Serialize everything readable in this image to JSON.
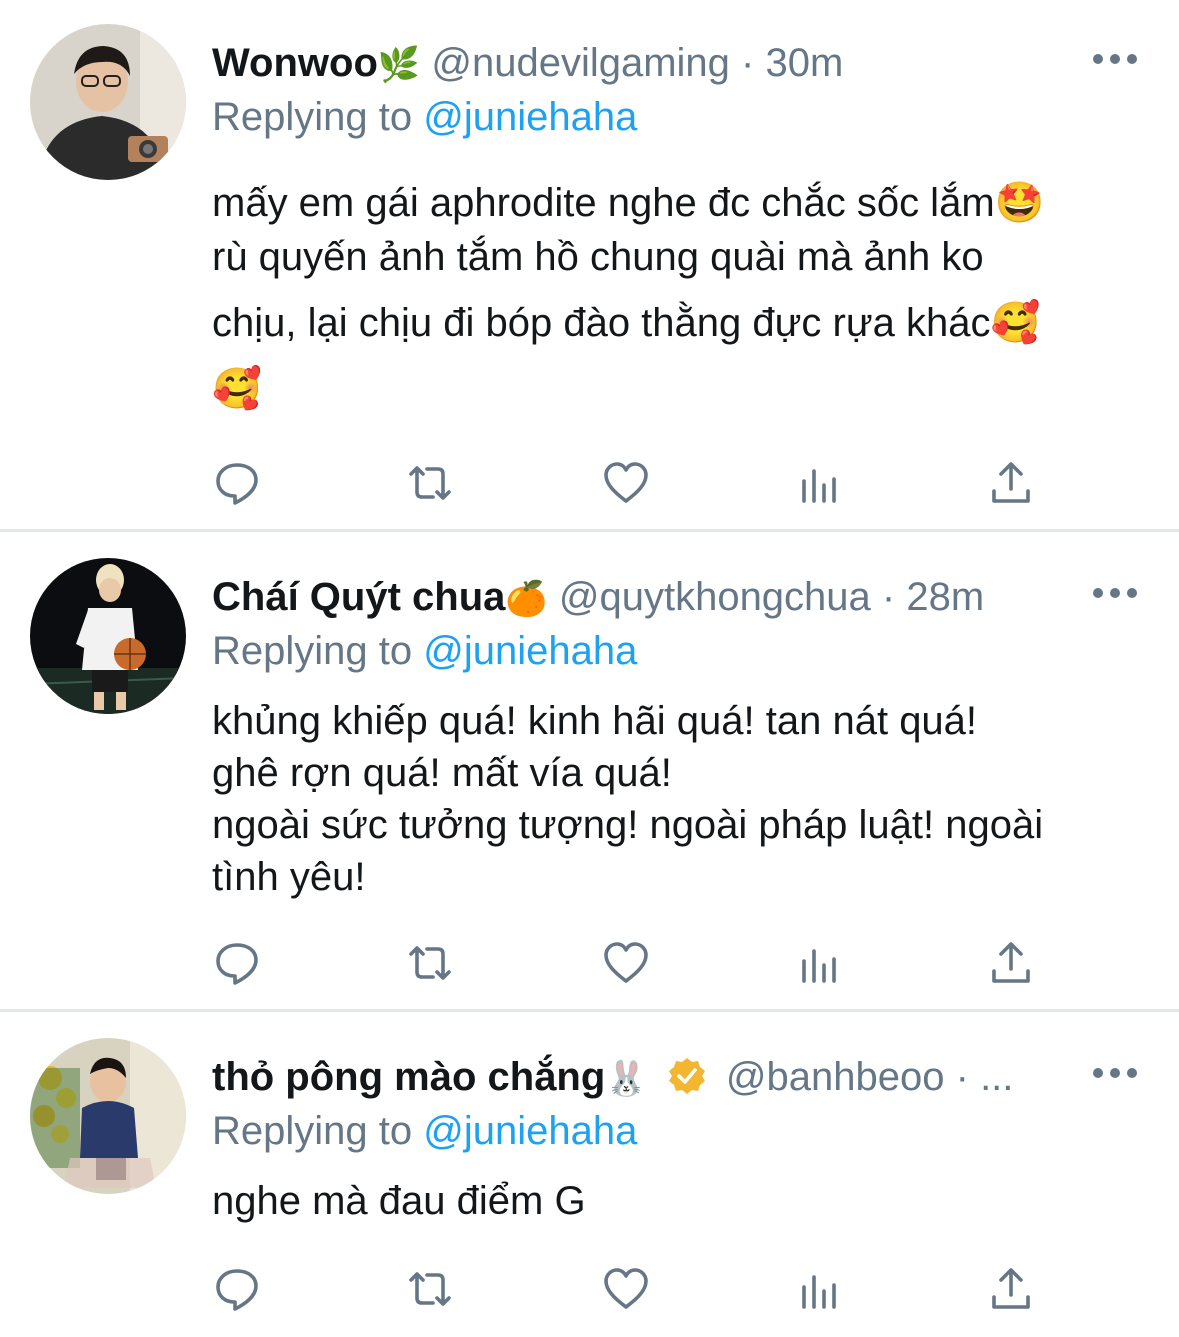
{
  "tweets": [
    {
      "name": "Wonwoo",
      "name_emoji": "🌿",
      "handle": "@nudevilgaming",
      "separator": "·",
      "time": "30m",
      "replying_label": "Replying to",
      "replying_handle": "@juniehaha",
      "lines": [
        "mấy em gái aphrodite nghe đc chắc sốc lắm🤩",
        "rù quyến ảnh tắm hồ chung quài mà ảnh ko",
        "chịu, lại chịu đi bóp đào thằng đực rựa khác🥰",
        "🥰"
      ]
    },
    {
      "name": "Cháí Quýt chua",
      "name_emoji": "🍊",
      "handle": "@quytkhongchua",
      "separator": "·",
      "time": "28m",
      "replying_label": "Replying to",
      "replying_handle": "@juniehaha",
      "lines": [
        "khủng khiếp quá! kinh hãi quá! tan nát quá!",
        "ghê rợn quá! mất vía quá!",
        "ngoài sức tưởng tượng! ngoài pháp luật! ngoài",
        "tình yêu!"
      ]
    },
    {
      "name": "thỏ pông mào chắng",
      "name_emoji": "🐰",
      "handle": "@banhbeoo",
      "separator": "·",
      "time": "...",
      "replying_label": "Replying to",
      "replying_handle": "@juniehaha",
      "lines": [
        "nghe mà đau điểm G"
      ]
    }
  ],
  "icons": [
    "reply-icon",
    "retweet-icon",
    "like-icon",
    "analytics-icon",
    "share-icon",
    "more-icon",
    "verified-badge-icon"
  ],
  "colors": {
    "link": "#1da1f2",
    "muted": "#657786",
    "text": "#14171a",
    "divider": "#e1e8ed",
    "verified": "#f2b631"
  }
}
